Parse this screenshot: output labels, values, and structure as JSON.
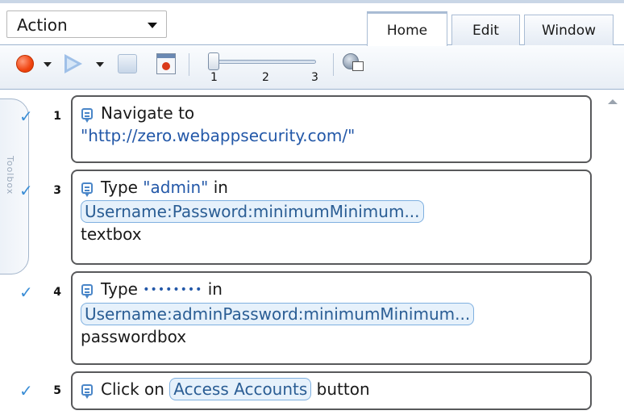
{
  "header": {
    "action_select": "Action",
    "tabs": [
      {
        "label": "Home",
        "active": true
      },
      {
        "label": "Edit",
        "active": false
      },
      {
        "label": "Window",
        "active": false
      }
    ],
    "accent_color": "#f0a030"
  },
  "toolbar": {
    "record_icon": "record-icon",
    "run_icon": "play-icon",
    "stop_icon": "stop-icon",
    "record_screen_icon": "record-screen-icon",
    "speed_slider": {
      "ticks": [
        "1",
        "2",
        "3"
      ],
      "value": 1
    },
    "object_spy_icon": "object-spy-icon"
  },
  "toolbox": {
    "label": "Toolbox"
  },
  "steps": [
    {
      "num": "1",
      "prefix": "Navigate to",
      "url": "\"http://zero.webappsecurity.com/\""
    },
    {
      "num": "3",
      "prefix": "Type",
      "value": "\"admin\"",
      "mid": "in",
      "object": "Username:Password:minimumMinimum...",
      "suffix": "textbox"
    },
    {
      "num": "4",
      "prefix": "Type",
      "value": "••••••••",
      "mid": "in",
      "object": "Username:adminPassword:minimumMinimum...",
      "suffix": "passwordbox"
    },
    {
      "num": "5",
      "prefix": "Click on",
      "object": "Access Accounts",
      "suffix": "button"
    }
  ],
  "colors": {
    "check": "#3b8ed6",
    "object_chip_border": "#7fb0e0",
    "value_text": "#2358a8"
  }
}
